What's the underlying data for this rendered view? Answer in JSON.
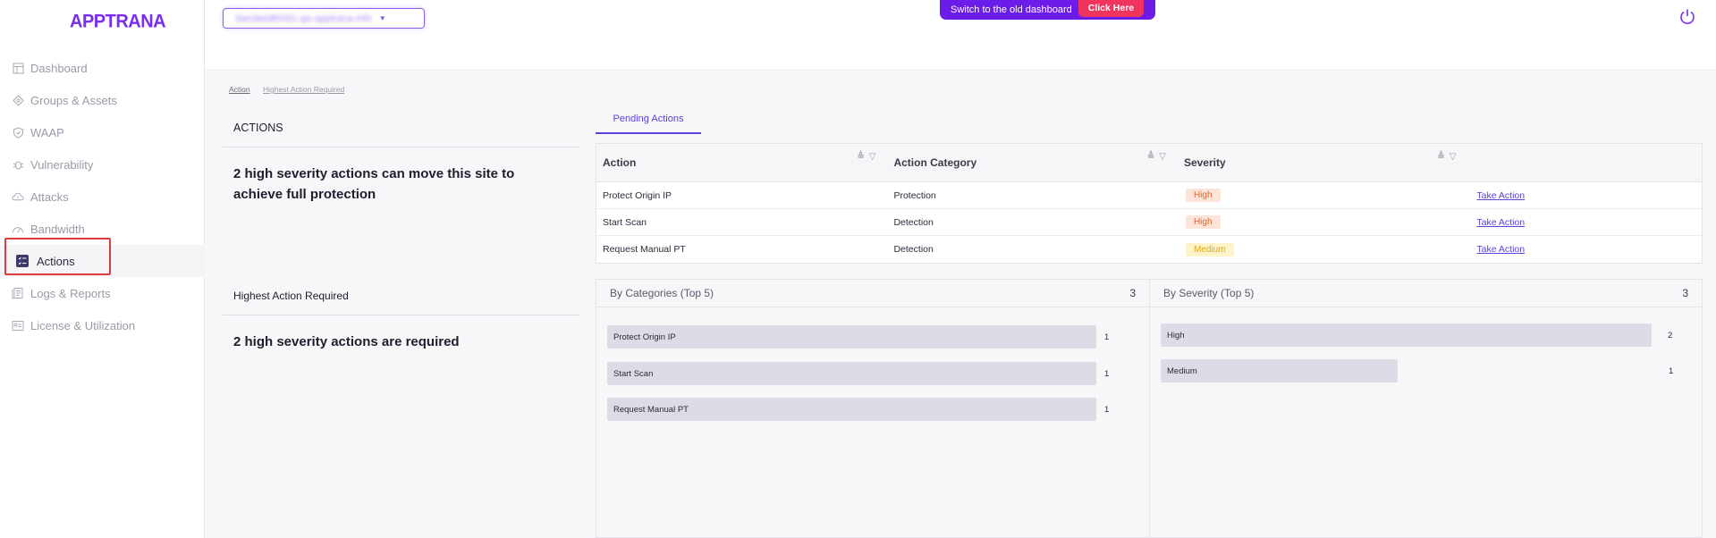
{
  "app": {
    "logo": "APPTRANA"
  },
  "sidebar": {
    "items": [
      {
        "label": "Dashboard",
        "icon": "dashboard-icon"
      },
      {
        "label": "Groups & Assets",
        "icon": "groups-icon"
      },
      {
        "label": "WAAP",
        "icon": "shield-icon"
      },
      {
        "label": "Vulnerability",
        "icon": "bug-icon"
      },
      {
        "label": "Attacks",
        "icon": "cloud-icon"
      },
      {
        "label": "Bandwidth",
        "icon": "gauge-icon"
      },
      {
        "label": "Actions",
        "icon": "checklist-icon",
        "active": true
      },
      {
        "label": "Logs & Reports",
        "icon": "logs-icon"
      },
      {
        "label": "License & Utilization",
        "icon": "license-icon"
      }
    ]
  },
  "topbar": {
    "site_selector": "bandwidth001.qa-apptrana.info",
    "banner_text": "Switch to the old dashboard",
    "banner_button": "Click Here"
  },
  "breadcrumb": {
    "first": "Action",
    "second": "Highest Action Required"
  },
  "left": {
    "actions_title": "ACTIONS",
    "actions_text": "2 high severity actions can move this site to achieve full protection",
    "highest_title": "Highest Action Required",
    "highest_text": "2 high severity actions are required"
  },
  "tabs": [
    {
      "label": "Pending Actions"
    }
  ],
  "table": {
    "headers": [
      "Action",
      "Action Category",
      "Severity"
    ],
    "rows": [
      {
        "action": "Protect Origin IP",
        "category": "Protection",
        "severity": "High",
        "link": "Take Action"
      },
      {
        "action": "Start Scan",
        "category": "Detection",
        "severity": "High",
        "link": "Take Action"
      },
      {
        "action": "Request Manual PT",
        "category": "Detection",
        "severity": "Medium",
        "link": "Take Action"
      }
    ]
  },
  "charts": {
    "categories": {
      "title": "By Categories (Top 5)",
      "count": "3",
      "items": [
        {
          "label": "Protect Origin IP",
          "value": "1"
        },
        {
          "label": "Start Scan",
          "value": "1"
        },
        {
          "label": "Request Manual PT",
          "value": "1"
        }
      ]
    },
    "severity": {
      "title": "By Severity (Top 5)",
      "count": "3",
      "items": [
        {
          "label": "High",
          "value": "2"
        },
        {
          "label": "Medium",
          "value": "1"
        }
      ]
    }
  },
  "colors": {
    "accent": "#6c1ce8",
    "high": "#e0652e",
    "medium": "#e0a814",
    "highlight": "#e03b3b"
  }
}
